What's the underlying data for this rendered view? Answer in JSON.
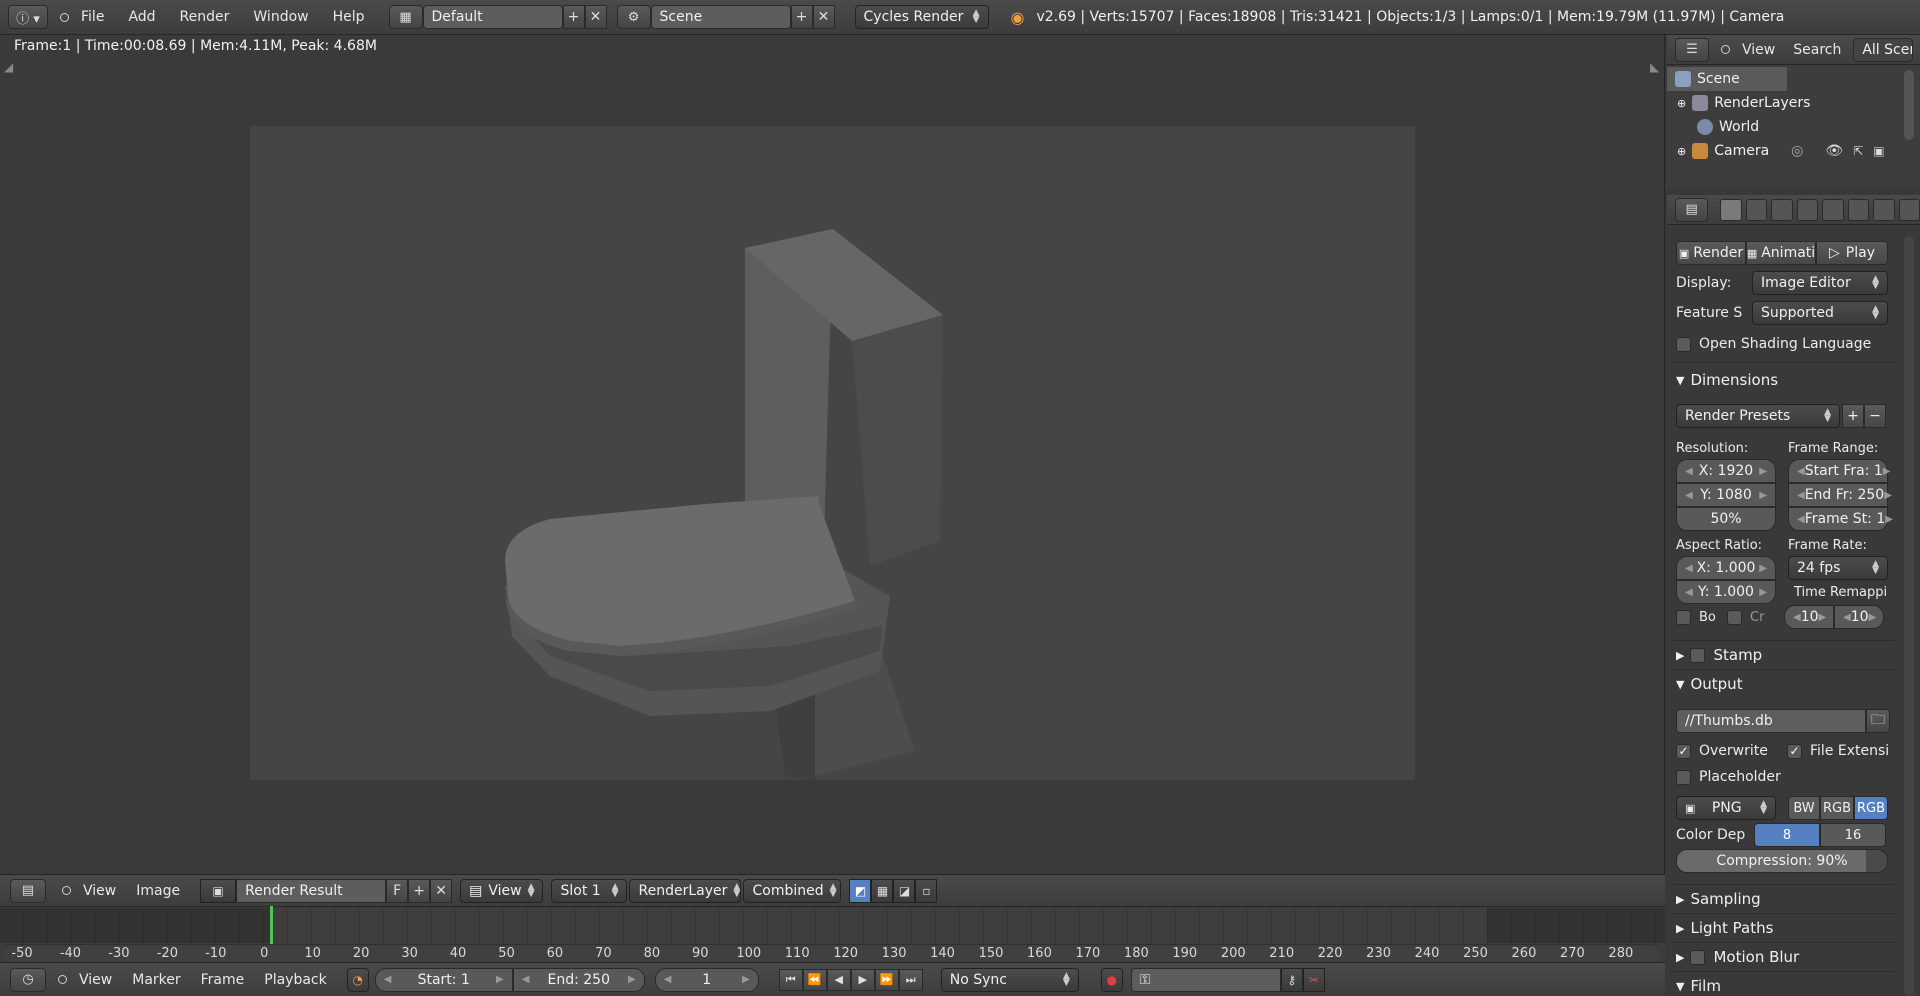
{
  "topbar": {
    "menus": [
      "File",
      "Add",
      "Render",
      "Window",
      "Help"
    ],
    "layout": "Default",
    "scene": "Scene",
    "engine": "Cycles Render",
    "stats": "v2.69 | Verts:15707 | Faces:18908 | Tris:31421 | Objects:1/3 | Lamps:0/1 | Mem:19.79M (11.97M) | Camera"
  },
  "viewport": {
    "render_info": "Frame:1 | Time:00:08.69 | Mem:4.11M, Peak: 4.68M"
  },
  "image_header": {
    "menus": [
      "View",
      "Image"
    ],
    "image_name": "Render Result",
    "fake_user": "F",
    "view": "View",
    "slot": "Slot 1",
    "layer": "RenderLayer",
    "pass": "Combined"
  },
  "timeline": {
    "ticks": [
      "-50",
      "-40",
      "-30",
      "-20",
      "-10",
      "0",
      "10",
      "20",
      "30",
      "40",
      "50",
      "60",
      "70",
      "80",
      "90",
      "100",
      "110",
      "120",
      "130",
      "140",
      "150",
      "160",
      "170",
      "180",
      "190",
      "200",
      "210",
      "220",
      "230",
      "240",
      "250",
      "260",
      "270",
      "280"
    ],
    "menus": [
      "View",
      "Marker",
      "Frame",
      "Playback"
    ],
    "start": "Start: 1",
    "end": "End: 250",
    "current": "1",
    "sync": "No Sync"
  },
  "outliner": {
    "menus": [
      "View",
      "Search"
    ],
    "filter": "All Scenes",
    "items": [
      "Scene",
      "RenderLayers",
      "World",
      "Camera"
    ]
  },
  "properties": {
    "render_buttons": [
      "Render",
      "Animati",
      "Play"
    ],
    "display_label": "Display:",
    "display_value": "Image Editor",
    "feature_label": "Feature S",
    "feature_value": "Supported",
    "osl_label": "Open Shading Language",
    "dimensions": {
      "title": "Dimensions",
      "presets": "Render Presets",
      "resolution_label": "Resolution:",
      "frame_range_label": "Frame Range:",
      "res_x": "X: 1920",
      "res_y": "Y: 1080",
      "res_pct": "50%",
      "start_frame": "Start Fra: 1",
      "end_frame": "End Fr: 250",
      "frame_step": "Frame St: 1",
      "aspect_label": "Aspect Ratio:",
      "frame_rate_label": "Frame Rate:",
      "aspect_x": "X: 1.000",
      "aspect_y": "Y: 1.000",
      "fps": "24 fps",
      "time_remap_label": "Time Remappi",
      "remap_old": "10",
      "remap_new": "10",
      "border_label": "Bo",
      "crop_label": "Cr"
    },
    "stamp": "Stamp",
    "output": {
      "title": "Output",
      "path": "//Thumbs.db",
      "overwrite": "Overwrite",
      "file_ext": "File Extensi",
      "placeholder": "Placeholder",
      "format": "PNG",
      "bw": "BW",
      "rgb": "RGB",
      "rgba": "RGB",
      "color_depth_label": "Color Dep",
      "depth_8": "8",
      "depth_16": "16",
      "compression": "Compression: 90%"
    },
    "sampling": "Sampling",
    "light_paths": "Light Paths",
    "motion_blur": "Motion Blur",
    "film": "Film"
  }
}
